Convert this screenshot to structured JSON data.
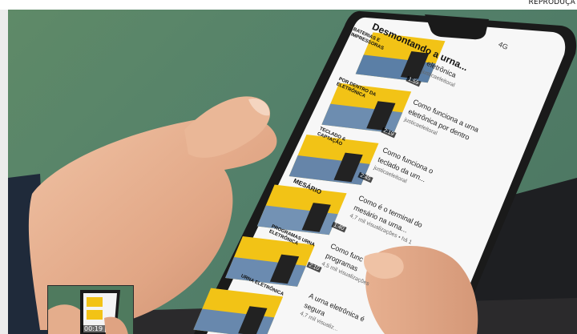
{
  "credit": "REPRODUÇÃ",
  "phone": {
    "playlist_title": "Desmontando a urna...",
    "status_network": "4G",
    "channel": "justicaeleitoral"
  },
  "videos": [
    {
      "thumb_text": "BATERIAS E IMPRESSORAS",
      "duration": "1:55",
      "title_lines": [
        "eletrônica"
      ],
      "meta": "justicaeleitoral"
    },
    {
      "thumb_text": "POR DENTRO DA ELETRÔNICA",
      "duration": "2:19",
      "title_lines": [
        "Como funciona a urna",
        "eletrônica por dentro"
      ],
      "meta": "justicaeleitoral"
    },
    {
      "thumb_text": "TECLADO & CAPTAÇÃO",
      "duration": "2:45",
      "title_lines": [
        "Como funciona o",
        "teclado da urn..."
      ],
      "meta": "justicaeleitoral"
    },
    {
      "thumb_text": "MESÁRIO",
      "duration": "1:40",
      "title_lines": [
        "Como é o terminal do",
        "mesário na urna..."
      ],
      "meta": "4,7 mil visualizações • há 1"
    },
    {
      "thumb_text": "PROGRAMAS URNA ELETRÔNICA",
      "duration": "2:10",
      "title_lines": [
        "Como func",
        "programas"
      ],
      "meta": "4,5 mil visualizações"
    },
    {
      "thumb_text": "URNA ELETRÔNICA",
      "duration": "",
      "title_lines": [
        "A urna eletrônica é",
        "segura"
      ],
      "meta": "4,7 mil visualiz..."
    }
  ],
  "inset": {
    "timecode": "00:19"
  },
  "colors": {
    "background_green": "#55836a",
    "thumb_yellow": "#f2c316",
    "phone_bezel": "#1a1a1a"
  }
}
